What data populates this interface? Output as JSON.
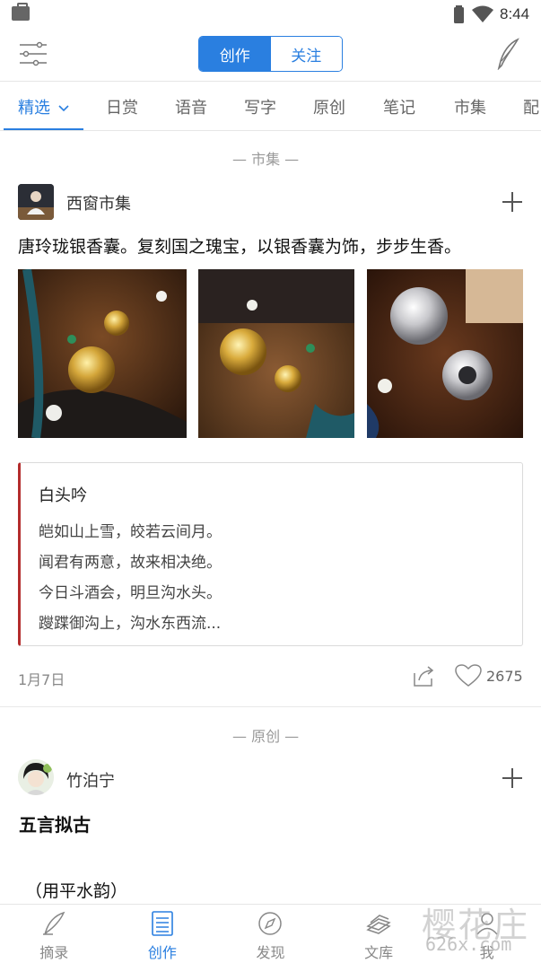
{
  "status_bar": {
    "time": "8:44"
  },
  "header": {
    "segments": [
      {
        "label": "创作",
        "active": true
      },
      {
        "label": "关注",
        "active": false
      }
    ]
  },
  "tabs": [
    {
      "label": "精选",
      "active": true
    },
    {
      "label": "日赏"
    },
    {
      "label": "语音"
    },
    {
      "label": "写字"
    },
    {
      "label": "原创"
    },
    {
      "label": "笔记"
    },
    {
      "label": "市集"
    },
    {
      "label": "配"
    }
  ],
  "feed": {
    "post1": {
      "section": "— 市集 —",
      "author": "西窗市集",
      "text": "唐玲珑银香囊。复刻国之瑰宝，以银香囊为饰，步步生香。",
      "quote": {
        "title": "白头吟",
        "lines": [
          "皑如山上雪，皎若云间月。",
          "闻君有两意，故来相决绝。",
          "今日斗酒会，明旦沟水头。",
          "躞蹀御沟上，沟水东西流..."
        ]
      },
      "date": "1月7日",
      "likes": "2675"
    },
    "post2": {
      "section": "— 原创 —",
      "author": "竹泊宁",
      "title": "五言拟古",
      "subtitle": "（用平水韵）"
    }
  },
  "bottom_nav": [
    {
      "label": "摘录",
      "icon": "quill-icon"
    },
    {
      "label": "创作",
      "icon": "document-icon",
      "active": true
    },
    {
      "label": "发现",
      "icon": "compass-icon"
    },
    {
      "label": "文库",
      "icon": "books-icon"
    },
    {
      "label": "我",
      "icon": "profile-icon"
    }
  ],
  "watermark": {
    "main": "樱花庄",
    "sub": "626x.com"
  },
  "colors": {
    "accent": "#2a7fe0",
    "quote_bar": "#b32c2c"
  }
}
